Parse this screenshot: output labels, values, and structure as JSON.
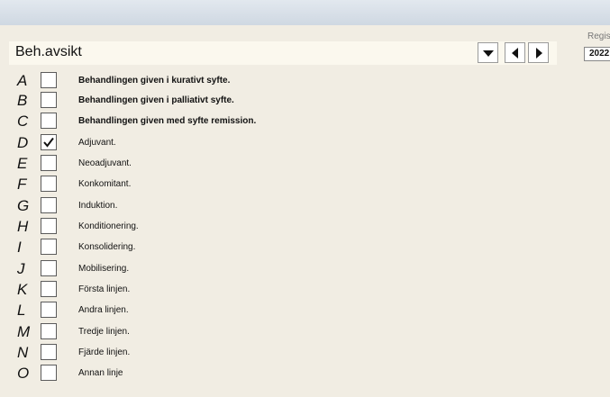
{
  "header": {
    "title": "Beh.avsikt",
    "registered_label": "Regis",
    "year_value": "2022"
  },
  "options": [
    {
      "letter": "A",
      "label": "Behandlingen given i kurativt syfte.",
      "bold": true,
      "checked": false
    },
    {
      "letter": "B",
      "label": "Behandlingen given i palliativt syfte.",
      "bold": true,
      "checked": false
    },
    {
      "letter": "C",
      "label": "Behandlingen given med syfte remission.",
      "bold": true,
      "checked": false
    },
    {
      "letter": "D",
      "label": "Adjuvant.",
      "bold": false,
      "checked": true
    },
    {
      "letter": "E",
      "label": "Neoadjuvant.",
      "bold": false,
      "checked": false
    },
    {
      "letter": "F",
      "label": "Konkomitant.",
      "bold": false,
      "checked": false
    },
    {
      "letter": "G",
      "label": "Induktion.",
      "bold": false,
      "checked": false
    },
    {
      "letter": "H",
      "label": "Konditionering.",
      "bold": false,
      "checked": false
    },
    {
      "letter": "I",
      "label": "Konsolidering.",
      "bold": false,
      "checked": false
    },
    {
      "letter": "J",
      "label": "Mobilisering.",
      "bold": false,
      "checked": false
    },
    {
      "letter": "K",
      "label": "Första linjen.",
      "bold": false,
      "checked": false
    },
    {
      "letter": "L",
      "label": "Andra linjen.",
      "bold": false,
      "checked": false
    },
    {
      "letter": "M",
      "label": "Tredje linjen.",
      "bold": false,
      "checked": false
    },
    {
      "letter": "N",
      "label": "Fjärde linjen.",
      "bold": false,
      "checked": false
    },
    {
      "letter": "O",
      "label": "Annan linje",
      "bold": false,
      "checked": false
    }
  ]
}
